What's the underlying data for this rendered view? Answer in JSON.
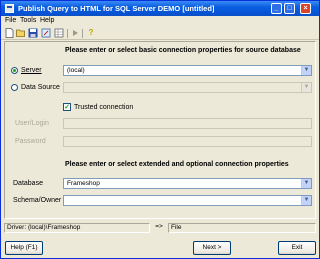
{
  "window": {
    "title": "Publish Query to HTML for SQL Server DEMO [untitled]",
    "minimize": "_",
    "maximize": "□",
    "close": "×"
  },
  "menu": {
    "file": "File",
    "tools": "Tools",
    "help": "Help"
  },
  "toolbar": {
    "icons": [
      "new-icon",
      "open-icon",
      "save-icon",
      "wizard-icon",
      "table-icon",
      "run-icon",
      "help-icon"
    ]
  },
  "source": {
    "heading": "Please enter or select basic connection properties for source database",
    "server_label": "Server",
    "server_value": "(local)",
    "datasource_label": "Data Source",
    "datasource_value": "",
    "trusted_label": "Trusted connection",
    "trusted_checked": true,
    "userlogin_label": "User/Login",
    "password_label": "Password"
  },
  "extended": {
    "heading": "Please enter or select extended and optional connection properties",
    "database_label": "Database",
    "database_value": "Frameshop",
    "schema_label": "Schema/Owner",
    "schema_value": ""
  },
  "statusbar": {
    "driver": "Driver: (local)\\Frameshop",
    "arrow": "=>",
    "target": "File"
  },
  "buttons": {
    "help": "Help (F1)",
    "next": "Next >",
    "exit": "Exit"
  },
  "colors": {
    "titlebar": "#0a5ee0",
    "window_bg": "#ece9d8",
    "check_mark": "#21a121"
  }
}
